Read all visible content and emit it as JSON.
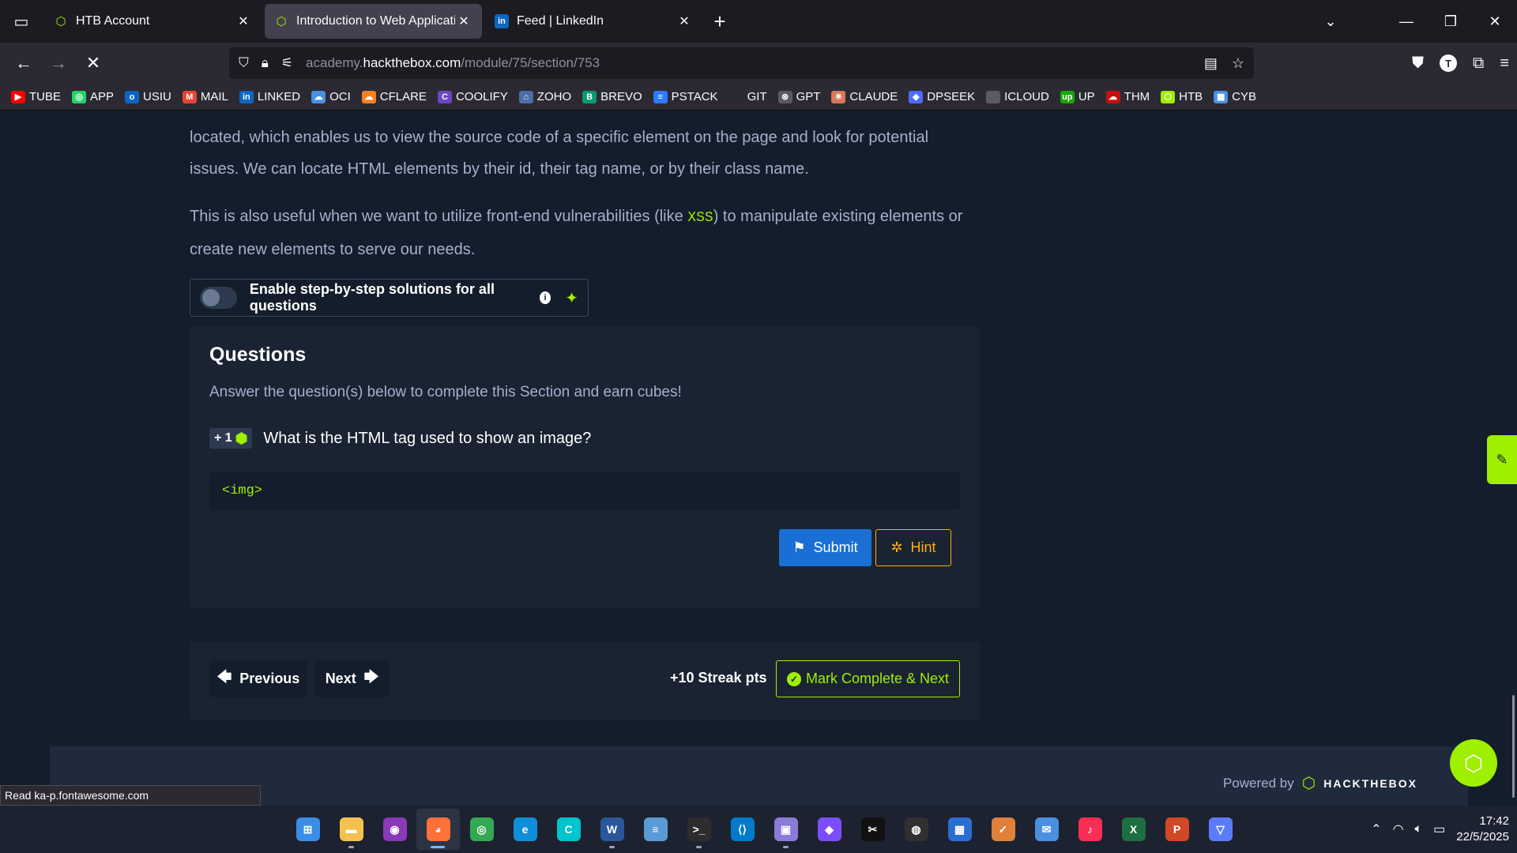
{
  "browser": {
    "tabs": [
      {
        "title": "HTB Account",
        "favicon": "htb-cube-icon",
        "active": false
      },
      {
        "title": "Introduction to Web Applicatior",
        "favicon": "htb-cube-icon",
        "active": true
      },
      {
        "title": "Feed | LinkedIn",
        "favicon": "linkedin-icon",
        "active": false
      }
    ],
    "url_prefix": "academy.",
    "url_domain": "hackthebox.com",
    "url_path": "/module/75/section/753",
    "bookmarks": [
      {
        "label": "TUBE",
        "color": "#ff0000",
        "glyph": "▶"
      },
      {
        "label": "APP",
        "color": "#25d366",
        "glyph": "◎"
      },
      {
        "label": "USIU",
        "color": "#0a66c2",
        "glyph": "o"
      },
      {
        "label": "MAIL",
        "color": "#ea4335",
        "glyph": "M"
      },
      {
        "label": "LINKED",
        "color": "#0a66c2",
        "glyph": "in"
      },
      {
        "label": "OCI",
        "color": "#4a90e2",
        "glyph": "☁"
      },
      {
        "label": "CFLARE",
        "color": "#f48120",
        "glyph": "☁"
      },
      {
        "label": "COOLIFY",
        "color": "#6b46c1",
        "glyph": "C"
      },
      {
        "label": "ZOHO",
        "color": "#4a6fa5",
        "glyph": "⌂"
      },
      {
        "label": "BREVO",
        "color": "#0b996e",
        "glyph": "B"
      },
      {
        "label": "PSTACK",
        "color": "#2b7bff",
        "glyph": "≡"
      },
      {
        "label": "GIT",
        "color": "#2b2a33",
        "glyph": ""
      },
      {
        "label": "GPT",
        "color": "#5a5a66",
        "glyph": "⊛"
      },
      {
        "label": "CLAUDE",
        "color": "#d97757",
        "glyph": "✳"
      },
      {
        "label": "DPSEEK",
        "color": "#4d6bfe",
        "glyph": "◆"
      },
      {
        "label": "ICLOUD",
        "color": "#5a5a66",
        "glyph": ""
      },
      {
        "label": "UP",
        "color": "#14a800",
        "glyph": "up"
      },
      {
        "label": "THM",
        "color": "#c11111",
        "glyph": "☁"
      },
      {
        "label": "HTB",
        "color": "#9fef00",
        "glyph": "⬡"
      },
      {
        "label": "CYB",
        "color": "#4a90e2",
        "glyph": "▦"
      }
    ]
  },
  "content": {
    "para1_line1": "located, which enables us to view the source code of a specific element on the page and look for potential",
    "para1_line2": "issues. We can locate HTML elements by their id, their tag name, or by their class name.",
    "para2_before": "This is also useful when we want to utilize front-end vulnerabilities (like ",
    "para2_code": "XSS",
    "para2_after": ") to manipulate existing elements or create new elements to serve our needs.",
    "toggle_label": "Enable step-by-step solutions for all questions"
  },
  "questions": {
    "heading": "Questions",
    "subheading": "Answer the question(s) below to complete this Section and earn cubes!",
    "badge": "+ 1",
    "question": "What is the HTML tag used to show an image?",
    "answer_value": "<img>",
    "submit_label": "Submit",
    "hint_label": "Hint"
  },
  "navigation": {
    "previous_label": "Previous",
    "next_label": "Next",
    "streak": "+10 Streak pts",
    "mark_label": "Mark Complete & Next"
  },
  "footer": {
    "powered_by": "Powered by",
    "brand": "HACKTHEBOX"
  },
  "status_text": "Read ka-p.fontawesome.com",
  "taskbar": {
    "apps": [
      {
        "name": "windows-start-icon",
        "color": "#3a8ee6",
        "glyph": "⊞",
        "dot": false
      },
      {
        "name": "file-explorer-icon",
        "color": "#f2c14e",
        "glyph": "▬",
        "dot": true
      },
      {
        "name": "app-mask-icon",
        "color": "#8a3ab9",
        "glyph": "◉",
        "dot": false
      },
      {
        "name": "firefox-icon",
        "color": "#ff7139",
        "glyph": "◕",
        "dot": true,
        "active": true
      },
      {
        "name": "chrome-icon",
        "color": "#34a853",
        "glyph": "◎",
        "dot": false
      },
      {
        "name": "edge-icon",
        "color": "#0f8fd9",
        "glyph": "e",
        "dot": false
      },
      {
        "name": "canva-icon",
        "color": "#00c4cc",
        "glyph": "C",
        "dot": false
      },
      {
        "name": "word-icon",
        "color": "#2b579a",
        "glyph": "W",
        "dot": true
      },
      {
        "name": "notepad-icon",
        "color": "#5b9bd5",
        "glyph": "≡",
        "dot": false
      },
      {
        "name": "terminal-icon",
        "color": "#2d2d2d",
        "glyph": ">_",
        "dot": true
      },
      {
        "name": "vscode-icon",
        "color": "#007acc",
        "glyph": "⟨⟩",
        "dot": false
      },
      {
        "name": "app-purple-icon",
        "color": "#8a7bd8",
        "glyph": "▣",
        "dot": true
      },
      {
        "name": "obsidian-icon",
        "color": "#7c4dff",
        "glyph": "◆",
        "dot": false
      },
      {
        "name": "capcut-icon",
        "color": "#111111",
        "glyph": "✂",
        "dot": false
      },
      {
        "name": "obs-icon",
        "color": "#303030",
        "glyph": "◍",
        "dot": false
      },
      {
        "name": "store-icon",
        "color": "#2a6ed3",
        "glyph": "▦",
        "dot": false
      },
      {
        "name": "todo-icon",
        "color": "#e0803a",
        "glyph": "✓",
        "dot": false
      },
      {
        "name": "mail-icon",
        "color": "#4a90e2",
        "glyph": "✉",
        "dot": false
      },
      {
        "name": "music-icon",
        "color": "#fa2d55",
        "glyph": "♪",
        "dot": false
      },
      {
        "name": "excel-icon",
        "color": "#1d6f42",
        "glyph": "X",
        "dot": false
      },
      {
        "name": "powerpoint-icon",
        "color": "#d24726",
        "glyph": "P",
        "dot": false
      },
      {
        "name": "vpn-icon",
        "color": "#5b7cfa",
        "glyph": "▽",
        "dot": false
      }
    ],
    "time": "17:42",
    "date": "22/5/2025"
  }
}
